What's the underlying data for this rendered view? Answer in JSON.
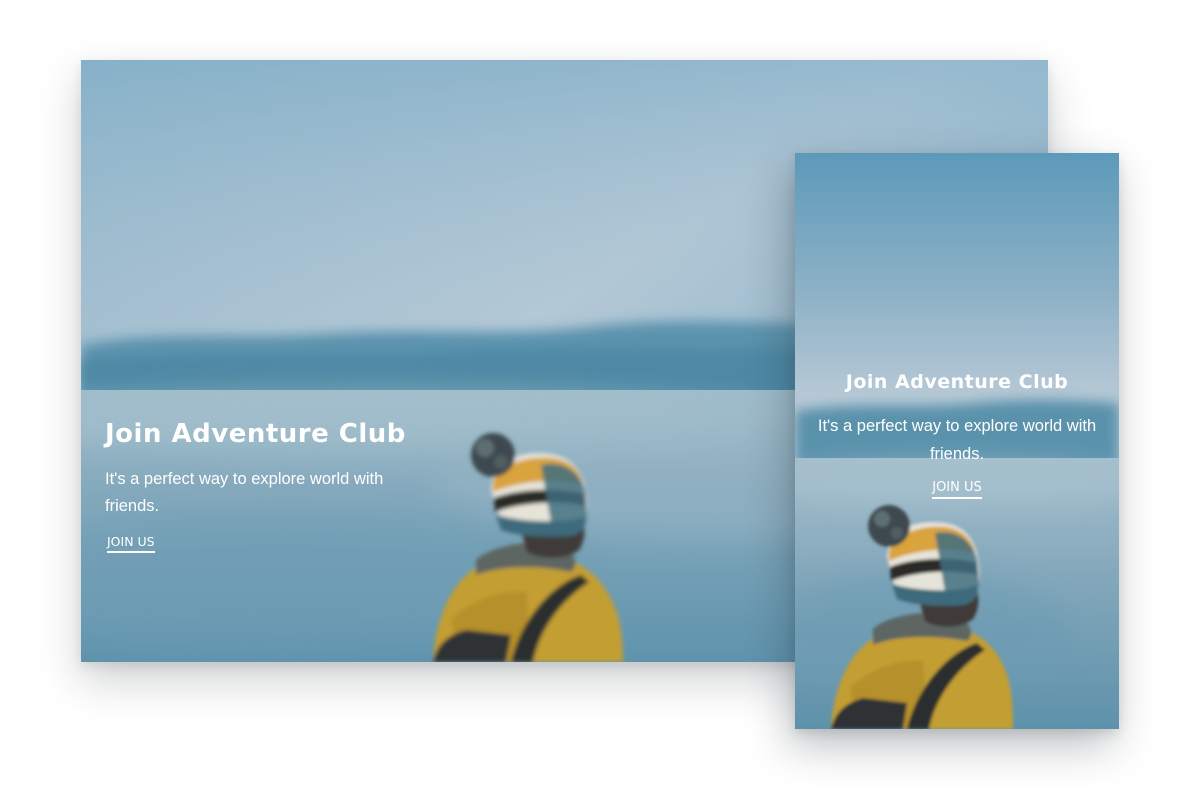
{
  "desktop_card": {
    "title": "Join Adventure Club",
    "subtitle": "It's a perfect way to explore world with friends.",
    "cta_label": "JOIN US"
  },
  "mobile_card": {
    "title": "Join Adventure Club",
    "subtitle": "It's a perfect way to explore world with friends.",
    "cta_label": "JOIN US"
  },
  "colors": {
    "sky_top": "#5f9cb9",
    "sky_mid": "#b9cbd7",
    "cloud": "#4d8aa5",
    "fog": "#7fa9bd",
    "jacket": "#c9a22f",
    "text": "#ffffff"
  }
}
